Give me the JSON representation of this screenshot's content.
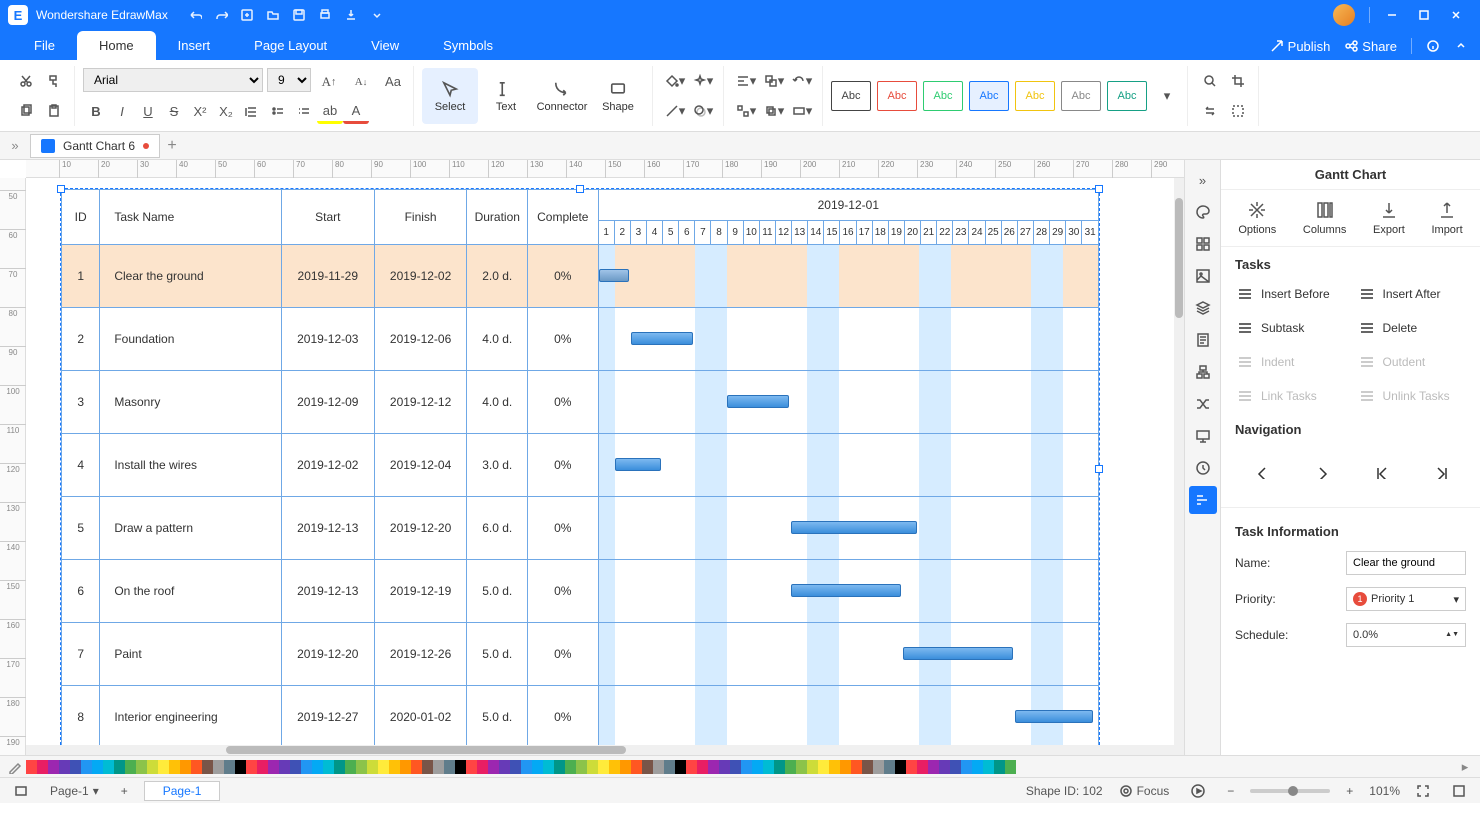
{
  "app_title": "Wondershare EdrawMax",
  "menubar": {
    "tabs": [
      "File",
      "Home",
      "Insert",
      "Page Layout",
      "View",
      "Symbols"
    ],
    "active": 1,
    "publish": "Publish",
    "share": "Share"
  },
  "ribbon": {
    "font_name": "Arial",
    "font_size": "9",
    "tools": [
      "Select",
      "Text",
      "Connector",
      "Shape"
    ],
    "style_labels": [
      "Abc",
      "Abc",
      "Abc",
      "Abc",
      "Abc",
      "Abc",
      "Abc"
    ],
    "style_borders": [
      "#444",
      "#e74c3c",
      "#2ecc71",
      "#1677ff",
      "#f1c40f",
      "#888",
      "#16a085"
    ]
  },
  "doctab": {
    "name": "Gantt Chart 6"
  },
  "gantt": {
    "month": "2019-12-01",
    "headers": {
      "id": "ID",
      "task": "Task Name",
      "start": "Start",
      "finish": "Finish",
      "duration": "Duration",
      "complete": "Complete"
    },
    "days": [
      1,
      2,
      3,
      4,
      5,
      6,
      7,
      8,
      9,
      10,
      11,
      12,
      13,
      14,
      15,
      16,
      17,
      18,
      19,
      20,
      21,
      22,
      23,
      24,
      25,
      26,
      27,
      28,
      29,
      30,
      31
    ],
    "weekends": [
      1,
      7,
      8,
      14,
      15,
      21,
      22,
      28,
      29
    ],
    "rows": [
      {
        "id": 1,
        "name": "Clear the ground",
        "start": "2019-11-29",
        "finish": "2019-12-02",
        "dur": "2.0 d.",
        "comp": "0%",
        "bar_from": 0,
        "bar_days": 2,
        "selected": true
      },
      {
        "id": 2,
        "name": "Foundation",
        "start": "2019-12-03",
        "finish": "2019-12-06",
        "dur": "4.0 d.",
        "comp": "0%",
        "bar_from": 2,
        "bar_days": 4
      },
      {
        "id": 3,
        "name": "Masonry",
        "start": "2019-12-09",
        "finish": "2019-12-12",
        "dur": "4.0 d.",
        "comp": "0%",
        "bar_from": 8,
        "bar_days": 4
      },
      {
        "id": 4,
        "name": "Install the wires",
        "start": "2019-12-02",
        "finish": "2019-12-04",
        "dur": "3.0 d.",
        "comp": "0%",
        "bar_from": 1,
        "bar_days": 3
      },
      {
        "id": 5,
        "name": "Draw a pattern",
        "start": "2019-12-13",
        "finish": "2019-12-20",
        "dur": "6.0 d.",
        "comp": "0%",
        "bar_from": 12,
        "bar_days": 8
      },
      {
        "id": 6,
        "name": "On the roof",
        "start": "2019-12-13",
        "finish": "2019-12-19",
        "dur": "5.0 d.",
        "comp": "0%",
        "bar_from": 12,
        "bar_days": 7
      },
      {
        "id": 7,
        "name": "Paint",
        "start": "2019-12-20",
        "finish": "2019-12-26",
        "dur": "5.0 d.",
        "comp": "0%",
        "bar_from": 19,
        "bar_days": 7
      },
      {
        "id": 8,
        "name": "Interior engineering",
        "start": "2019-12-27",
        "finish": "2020-01-02",
        "dur": "5.0 d.",
        "comp": "0%",
        "bar_from": 26,
        "bar_days": 5
      }
    ]
  },
  "sidepanel": {
    "title": "Gantt Chart",
    "actions": [
      "Options",
      "Columns",
      "Export",
      "Import"
    ],
    "tasks_h": "Tasks",
    "task_btns": [
      "Insert Before",
      "Insert After",
      "Subtask",
      "Delete",
      "Indent",
      "Outdent",
      "Link Tasks",
      "Unlink Tasks"
    ],
    "nav_h": "Navigation",
    "ti_h": "Task Information",
    "name_l": "Name:",
    "name_v": "Clear the ground",
    "prio_l": "Priority:",
    "prio_v": "Priority 1",
    "sched_l": "Schedule:",
    "sched_v": "0.0%"
  },
  "ruler_h": [
    10,
    20,
    30,
    40,
    50,
    60,
    70,
    80,
    90,
    100,
    110,
    120,
    130,
    140,
    150,
    160,
    170,
    180,
    190,
    200,
    210,
    220,
    230,
    240,
    250,
    260,
    270,
    280,
    290
  ],
  "ruler_v": [
    50,
    60,
    70,
    80,
    90,
    100,
    110,
    120,
    130,
    140,
    150,
    160,
    170,
    180,
    190
  ],
  "palette_colors": [
    "#f44",
    "#e91e63",
    "#9c27b0",
    "#673ab7",
    "#3f51b5",
    "#2196f3",
    "#03a9f4",
    "#00bcd4",
    "#009688",
    "#4caf50",
    "#8bc34a",
    "#cddc39",
    "#ffeb3b",
    "#ffc107",
    "#ff9800",
    "#ff5722",
    "#795548",
    "#9e9e9e",
    "#607d8b",
    "#000"
  ],
  "status": {
    "page_sel": "Page-1",
    "page_tab": "Page-1",
    "shape_id": "Shape ID: 102",
    "focus": "Focus",
    "zoom": "101%"
  }
}
